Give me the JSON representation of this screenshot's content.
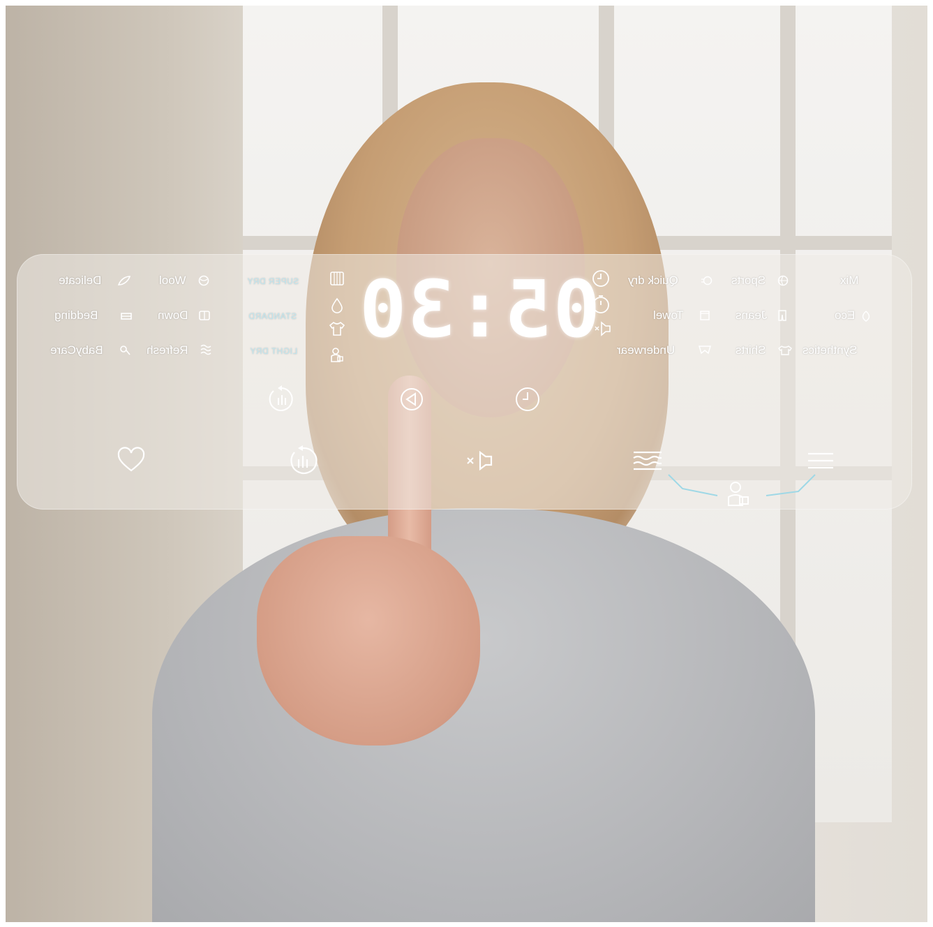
{
  "display": {
    "time": "05:30"
  },
  "programs": {
    "left_col1": [
      "Delicate",
      "Bedding",
      "BabyCare"
    ],
    "left_col2": [
      "Wool",
      "Down",
      "Refresh"
    ],
    "dry_levels": [
      "SUPER DRY",
      "STANDARD",
      "LIGHT DRY"
    ],
    "right_col1": [
      "Quick dry",
      "Towel",
      "Underwear"
    ],
    "right_col2": [
      "Sports",
      "Jeans",
      "Shirts"
    ],
    "right_col3": [
      "Mix",
      "Eco",
      "Synthetics"
    ]
  },
  "icons": {
    "left_status": [
      "drum-icon",
      "water-drop-icon",
      "shirt-icon",
      "child-lock-icon"
    ],
    "right_status": [
      "clock-icon",
      "timer-icon",
      "mute-icon"
    ],
    "middle_row": [
      "dry-level-icon",
      "start-pause-icon",
      "delay-clock-icon"
    ],
    "bottom_row": [
      "favorite-heart-icon",
      "dry-level-icon",
      "mute-icon",
      "steam-icon",
      "menu-icon",
      "child-lock-icon"
    ]
  },
  "colors": {
    "panel": "#eeebe6",
    "accent": "#9fd8e6",
    "text": "#ffffff"
  }
}
